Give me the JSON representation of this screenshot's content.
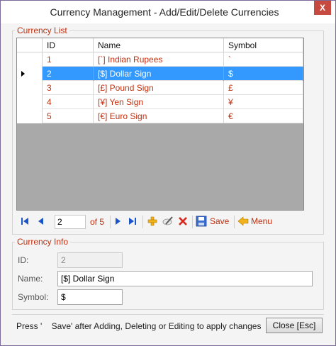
{
  "window": {
    "title": "Currency Management - Add/Edit/Delete Currencies",
    "close_glyph": "X"
  },
  "currency_list": {
    "legend": "Currency List",
    "columns": [
      "ID",
      "Name",
      "Symbol"
    ],
    "rows": [
      {
        "id": "1",
        "name": "[`] Indian Rupees",
        "symbol": "`"
      },
      {
        "id": "2",
        "name": "[$] Dollar Sign",
        "symbol": "$"
      },
      {
        "id": "3",
        "name": "[£] Pound Sign",
        "symbol": "£"
      },
      {
        "id": "4",
        "name": "[¥] Yen Sign",
        "symbol": "¥"
      },
      {
        "id": "5",
        "name": "[€] Euro Sign",
        "symbol": "€"
      }
    ],
    "selected_row": 1
  },
  "navigator": {
    "position": "2",
    "count_label": "of 5",
    "save_label": "Save",
    "menu_label": "Menu",
    "icons": [
      "first-record-icon",
      "previous-record-icon",
      "next-record-icon",
      "last-record-icon",
      "add-icon",
      "edit-icon",
      "delete-icon",
      "save-icon",
      "menu-back-icon"
    ]
  },
  "currency_info": {
    "legend": "Currency Info",
    "id_label": "ID:",
    "id_value": "2",
    "name_label": "Name:",
    "name_value": "[$] Dollar Sign",
    "symbol_label": "Symbol:",
    "symbol_value": "$"
  },
  "footer": {
    "status": "Press '    Save' after Adding, Deleting or Editing to apply changes",
    "close_label": "Close [Esc]"
  },
  "colors": {
    "accent_text": "#c03010",
    "selection": "#3399ff",
    "grid_background": "#a9a9a9"
  }
}
